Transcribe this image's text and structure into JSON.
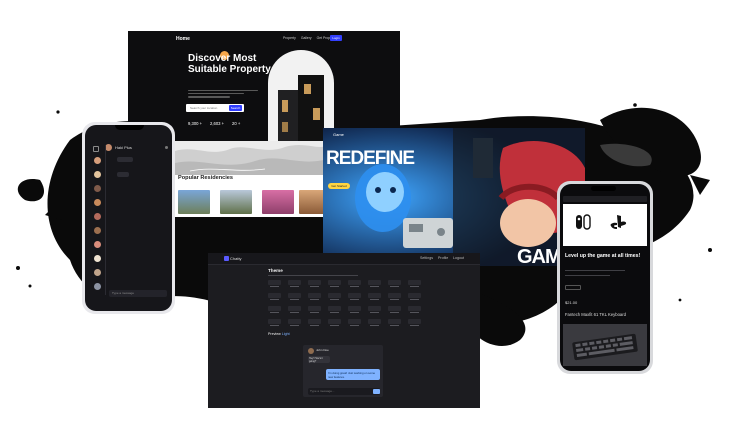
{
  "property": {
    "logo": "Home",
    "nav": [
      "Property",
      "Gallery",
      "Get Property"
    ],
    "cta": "Login",
    "title": "Discover Most Suitable Property",
    "search_placeholder": "Search your location",
    "search_button": "Search",
    "stats": [
      "9,300 +",
      "2,603 +",
      "20 +"
    ],
    "accent": "#3340ff"
  },
  "chat_app": {
    "contact_name": "Haki Plus",
    "message_placeholder": "Type a message"
  },
  "realestate": {
    "heading": "Popular Residencies"
  },
  "gaming": {
    "brand": "Game",
    "hero_1": "REDEFINE",
    "hero_2": "GAMING",
    "button": "Get Started",
    "accent": "#ffd541"
  },
  "themes_app": {
    "brand": "Chatty",
    "actions": [
      "Settings",
      "Profile",
      "Logout"
    ],
    "heading": "Theme",
    "preview_label": "Preview",
    "preview_value": "Light",
    "contact": "John Doe",
    "received_message": "Hey! How's it going?",
    "sent_message": "I'm doing great! Just working on some new features.",
    "input_placeholder": "Type a message..."
  },
  "shop_phone": {
    "headline": "Level up the game at all times!",
    "price": "$21.00",
    "product": "Fantech Maxfit 61 TKL Keyboard",
    "icons": [
      "switch-icon",
      "playstation-icon"
    ]
  }
}
